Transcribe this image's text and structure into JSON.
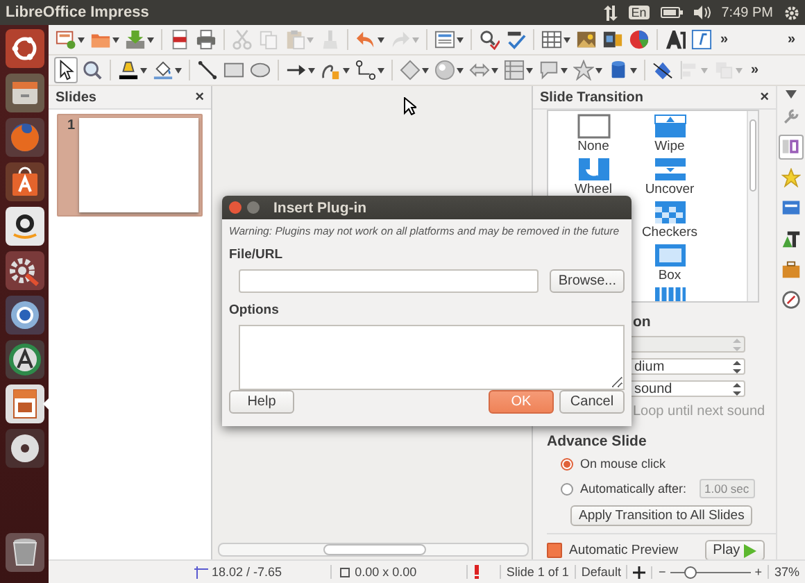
{
  "top_bar": {
    "title": "LibreOffice Impress",
    "keyboard": "En",
    "time": "7:49 PM"
  },
  "launcher": [
    {
      "kind": "ubuntu",
      "active": false
    },
    {
      "kind": "files",
      "active": false
    },
    {
      "kind": "firefox",
      "active": false
    },
    {
      "kind": "software",
      "active": false
    },
    {
      "kind": "amazon",
      "active": false
    },
    {
      "kind": "settings",
      "active": false
    },
    {
      "kind": "chromium",
      "active": false
    },
    {
      "kind": "updater",
      "active": false
    },
    {
      "kind": "impress",
      "active": true
    },
    {
      "kind": "disc",
      "active": false
    }
  ],
  "launcher_bottom": [
    {
      "kind": "trash",
      "active": false
    }
  ],
  "toolbars": [
    {
      "items": [
        {
          "kind": "slide",
          "dropdown": true,
          "disabled": false,
          "pressed": false
        },
        {
          "kind": "folder",
          "dropdown": true,
          "disabled": false,
          "pressed": false
        },
        {
          "kind": "tray",
          "dropdown": true,
          "disabled": false,
          "pressed": false
        },
        {
          "kind": "separator"
        },
        {
          "kind": "pdf",
          "dropdown": false,
          "disabled": false,
          "pressed": false
        },
        {
          "kind": "printer",
          "dropdown": false,
          "disabled": false,
          "pressed": false
        },
        {
          "kind": "separator"
        },
        {
          "kind": "scissors",
          "dropdown": false,
          "disabled": true,
          "pressed": false
        },
        {
          "kind": "copy",
          "dropdown": false,
          "disabled": true,
          "pressed": false
        },
        {
          "kind": "clipboard",
          "dropdown": true,
          "disabled": true,
          "pressed": false
        },
        {
          "kind": "brush",
          "dropdown": false,
          "disabled": true,
          "pressed": false
        },
        {
          "kind": "separator"
        },
        {
          "kind": "undo",
          "dropdown": true,
          "disabled": false,
          "pressed": false
        },
        {
          "kind": "redo",
          "dropdown": true,
          "disabled": true,
          "pressed": false
        },
        {
          "kind": "separator"
        },
        {
          "kind": "layout",
          "dropdown": true,
          "disabled": false,
          "pressed": false
        },
        {
          "kind": "separator"
        },
        {
          "kind": "spellcheck",
          "dropdown": false,
          "disabled": false,
          "pressed": false
        },
        {
          "kind": "autospell",
          "dropdown": false,
          "disabled": false,
          "pressed": false
        },
        {
          "kind": "separator"
        },
        {
          "kind": "table",
          "dropdown": true,
          "disabled": false,
          "pressed": false
        },
        {
          "kind": "image",
          "dropdown": false,
          "disabled": false,
          "pressed": false
        },
        {
          "kind": "film",
          "dropdown": false,
          "disabled": false,
          "pressed": false
        },
        {
          "kind": "chart",
          "dropdown": false,
          "disabled": false,
          "pressed": false
        },
        {
          "kind": "separator"
        },
        {
          "kind": "fontwork",
          "dropdown": false,
          "disabled": false,
          "pressed": false
        },
        {
          "kind": "textbox",
          "dropdown": false,
          "disabled": false,
          "pressed": false
        }
      ],
      "overflow": [
        "»",
        "»"
      ]
    },
    {
      "items": [
        {
          "kind": "pointer",
          "dropdown": false,
          "disabled": false,
          "pressed": true
        },
        {
          "kind": "zoom",
          "dropdown": false,
          "disabled": false,
          "pressed": false
        },
        {
          "kind": "separator"
        },
        {
          "kind": "highlighter",
          "dropdown": true,
          "disabled": false,
          "pressed": false
        },
        {
          "kind": "bucket",
          "dropdown": true,
          "disabled": false,
          "pressed": false
        },
        {
          "kind": "separator"
        },
        {
          "kind": "line",
          "dropdown": false,
          "disabled": false,
          "pressed": false
        },
        {
          "kind": "rectangle",
          "dropdown": false,
          "disabled": false,
          "pressed": false
        },
        {
          "kind": "ellipse",
          "dropdown": false,
          "disabled": false,
          "pressed": false
        },
        {
          "kind": "separator"
        },
        {
          "kind": "arrow",
          "dropdown": true,
          "disabled": false,
          "pressed": false
        },
        {
          "kind": "curve",
          "dropdown": true,
          "disabled": false,
          "pressed": false
        },
        {
          "kind": "connector",
          "dropdown": true,
          "disabled": false,
          "pressed": false
        },
        {
          "kind": "separator"
        },
        {
          "kind": "diamond",
          "dropdown": true,
          "disabled": false,
          "pressed": false
        },
        {
          "kind": "sphere",
          "dropdown": true,
          "disabled": false,
          "pressed": false
        },
        {
          "kind": "symbol",
          "dropdown": true,
          "disabled": false,
          "pressed": false
        },
        {
          "kind": "flowchart",
          "dropdown": true,
          "disabled": false,
          "pressed": false
        },
        {
          "kind": "callout",
          "dropdown": true,
          "disabled": false,
          "pressed": false
        },
        {
          "kind": "star",
          "dropdown": true,
          "disabled": false,
          "pressed": false
        },
        {
          "kind": "cylinder",
          "dropdown": true,
          "disabled": false,
          "pressed": false
        },
        {
          "kind": "separator"
        },
        {
          "kind": "gluepoint",
          "dropdown": false,
          "disabled": false,
          "pressed": false
        },
        {
          "kind": "align",
          "dropdown": true,
          "disabled": true,
          "pressed": false
        },
        {
          "kind": "arrange",
          "dropdown": true,
          "disabled": true,
          "pressed": false
        }
      ],
      "overflow": [
        "»"
      ]
    }
  ],
  "slides_panel": {
    "title": "Slides",
    "close": "×",
    "slides": [
      {
        "number": "1",
        "selected": true
      }
    ]
  },
  "transition_panel": {
    "title": "Slide Transition",
    "close": "×",
    "transitions": [
      {
        "kind": "none",
        "label": "None",
        "selected": false
      },
      {
        "kind": "wipe",
        "label": "Wipe",
        "selected": false
      },
      {
        "kind": "wheel",
        "label": "Wheel",
        "selected": false
      },
      {
        "kind": "uncover",
        "label": "Uncover",
        "selected": false
      },
      {
        "kind": "hidden"
      },
      {
        "kind": "checkers",
        "label": "Checkers",
        "selected": false
      },
      {
        "kind": "hidden"
      },
      {
        "kind": "box",
        "label": "Box",
        "selected": false
      },
      {
        "kind": "hidden"
      },
      {
        "kind": "bars",
        "selected": false
      }
    ],
    "modify_title": "on",
    "dropdowns": [
      {
        "disabled": true
      },
      {
        "value": "dium",
        "disabled": false
      },
      {
        "value": "sound",
        "disabled": false
      }
    ],
    "loop": {
      "label": "Loop until next sound",
      "disabled": true
    },
    "advance_title": "Advance Slide",
    "advance_options": [
      {
        "label": "On mouse click",
        "selected": true
      },
      {
        "label": "Automatically after:",
        "selected": false
      }
    ],
    "delay": {
      "value": "1.00 sec",
      "disabled": true
    },
    "apply_button": "Apply Transition to All Slides",
    "preview": {
      "label": "Automatic Preview",
      "checked": true
    },
    "play_button": "Play"
  },
  "sidebar_tabs": [
    {
      "kind": "wrench",
      "selected": false
    },
    {
      "kind": "transition",
      "selected": true
    },
    {
      "kind": "star",
      "selected": false
    },
    {
      "kind": "master",
      "selected": false
    },
    {
      "kind": "styles",
      "selected": false
    },
    {
      "kind": "gallery",
      "selected": false
    },
    {
      "kind": "compass",
      "selected": false
    }
  ],
  "dialog": {
    "title": "Insert Plug-in",
    "warning": "Warning: Plugins may not work on all platforms and may be removed in the future",
    "file_label": "File/URL",
    "browse_button": "Browse...",
    "options_label": "Options",
    "buttons": [
      {
        "label": "Help",
        "kind": "normal"
      },
      {
        "label": "OK",
        "kind": "default"
      },
      {
        "label": "Cancel",
        "kind": "normal"
      }
    ]
  },
  "status_bar": {
    "position": "18.02 / -7.65",
    "size": "0.00 x 0.00",
    "slide": "Slide 1 of 1",
    "master": "Default",
    "zoom_out": "−",
    "zoom_in": "+",
    "level": 0.25,
    "zoom": "37%"
  }
}
